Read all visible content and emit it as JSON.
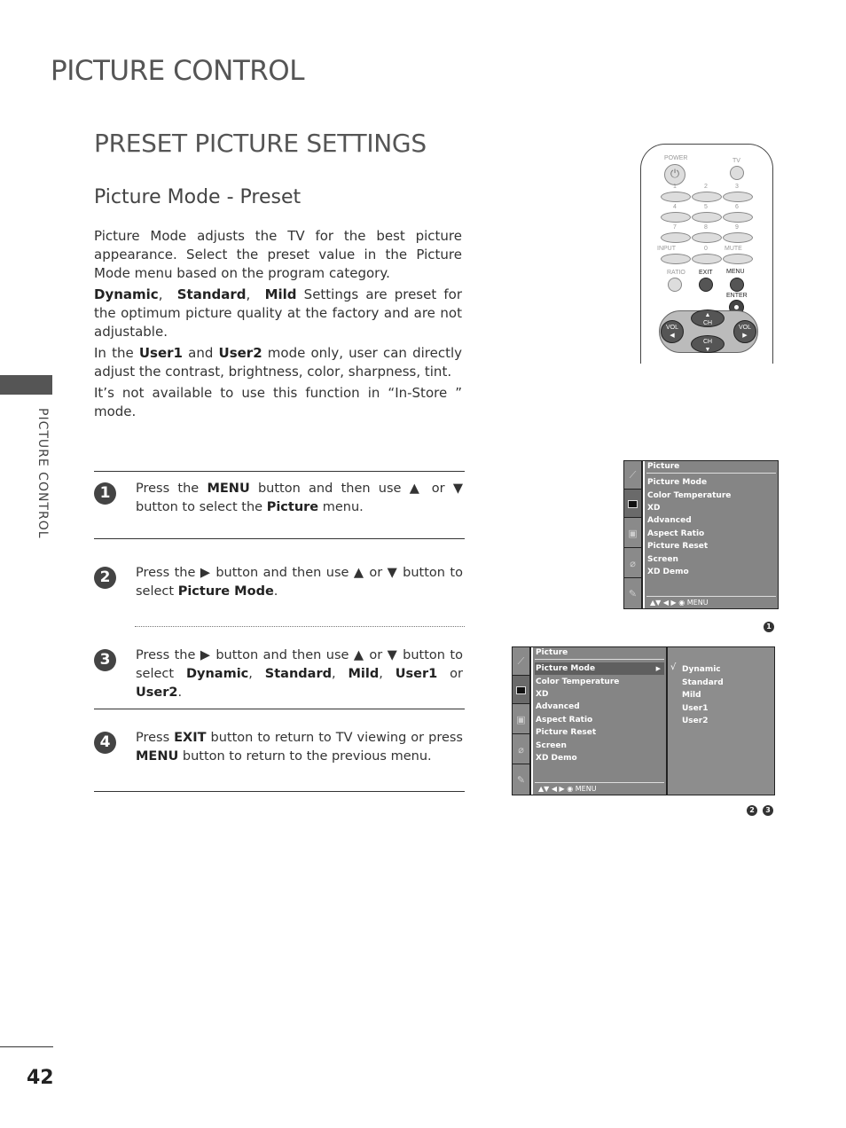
{
  "chapter_title": "PICTURE CONTROL",
  "section_title": "PRESET PICTURE SETTINGS",
  "sub_title": "Picture Mode - Preset",
  "side_label": "PICTURE CONTROL",
  "page_number": "42",
  "intro": {
    "p1": "Picture Mode adjusts the TV for the best picture appearance. Select the preset value in the Picture Mode menu based on the program category.",
    "p2_bold": [
      "Dynamic",
      "Standard",
      "Mild"
    ],
    "p2_rest": " Settings are preset for the optimum picture quality at the factory and are not adjustable.",
    "p3_pre": "In the ",
    "p3_b1": "User1",
    "p3_mid": " and ",
    "p3_b2": "User2",
    "p3_rest": " mode only, user can directly adjust the contrast, brightness, color, sharpness, tint.",
    "p4": "It’s not available to use this function in “In-Store ” mode."
  },
  "steps": [
    {
      "num": "1",
      "t1": "Press the ",
      "b1": "MENU",
      "t2": " button and then use ▲ or ▼ button to select the ",
      "b2": "Picture",
      "t3": " menu."
    },
    {
      "num": "2",
      "t1": "Press the ▶ button and then use ▲ or ▼ button to select ",
      "b1": "Picture Mode",
      "t2": "."
    },
    {
      "num": "3",
      "t1": "Press the ▶ button and then use ▲ or ▼ button to select ",
      "b1": "Dynamic",
      "s1": ", ",
      "b2": "Standard",
      "s2": ", ",
      "b3": "Mild",
      "s3": ", ",
      "b4": "User1",
      "s4": " or ",
      "b5": "User2",
      "s5": "."
    },
    {
      "num": "4",
      "t1": "Press ",
      "b1": "EXIT",
      "t2": " button to return to TV viewing or press ",
      "b2": "MENU",
      "t3": " button to return to the previous menu."
    }
  ],
  "remote": {
    "power": "POWER",
    "tv": "TV",
    "digits": [
      "1",
      "2",
      "3",
      "4",
      "5",
      "6",
      "7",
      "8",
      "9",
      "0"
    ],
    "input": "INPUT",
    "mute": "MUTE",
    "ratio": "RATIO",
    "exit": "EXIT",
    "menu": "MENU",
    "enter": "ENTER",
    "ch": "CH",
    "vol": "VOL"
  },
  "osd": {
    "header": "Picture",
    "items": [
      "Picture Mode",
      "Color Temperature",
      "XD",
      "Advanced",
      "Aspect Ratio",
      "Picture Reset",
      "Screen",
      "XD Demo"
    ],
    "footer": "▲▼  ◀ ▶   ◉   MENU",
    "selected_item": "Picture Mode",
    "options": [
      "Dynamic",
      "Standard",
      "Mild",
      "User1",
      "User2"
    ],
    "checked_option": "Dynamic",
    "check_mark": "√",
    "icons": [
      "antenna-icon",
      "picture-icon",
      "speaker-icon",
      "clock-icon",
      "option-tag-icon"
    ],
    "ref1": "1",
    "ref2": [
      "2",
      "3"
    ]
  }
}
